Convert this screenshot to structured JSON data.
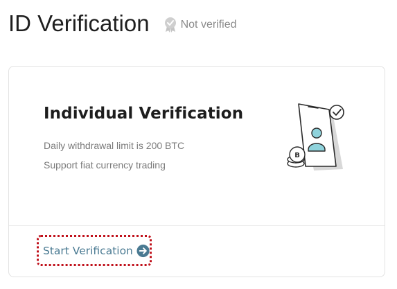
{
  "header": {
    "title": "ID Verification",
    "status_text": "Not verified",
    "status_icon": "badge-icon"
  },
  "card": {
    "title": "Individual Verification",
    "features": [
      "Daily withdrawal limit is 200 BTC",
      "Support fiat currency trading"
    ],
    "illustration": "phone-user-coin-illustration",
    "action": {
      "label": "Start Verification",
      "icon": "arrow-right-circle-icon"
    }
  },
  "colors": {
    "accent": "#4a7a92",
    "highlight_border": "#c0121c",
    "muted_text": "#8a8a8a"
  }
}
